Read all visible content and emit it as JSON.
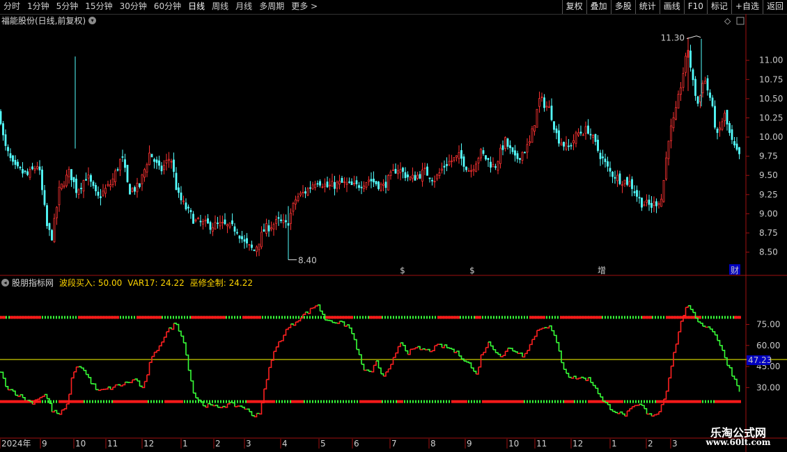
{
  "toolbar": {
    "tabs": [
      "分时",
      "1分钟",
      "5分钟",
      "15分钟",
      "30分钟",
      "60分钟",
      "日线",
      "周线",
      "月线",
      "多周期",
      "更多 >"
    ],
    "active_tab": "日线",
    "buttons": [
      "复权",
      "叠加",
      "多股",
      "统计",
      "画线",
      "F10",
      "标记",
      "+自选",
      "返回"
    ]
  },
  "main_panel": {
    "title": "福能股份(日线,前复权)",
    "high_label": "11.30",
    "low_label": "8.40",
    "markers": [
      "$",
      "$",
      "增",
      "财"
    ]
  },
  "indicator_panel": {
    "name": "股朋指标网",
    "items": [
      {
        "label": "波段买入:",
        "value": "50.00"
      },
      {
        "label": "VAR17:",
        "value": "24.22"
      },
      {
        "label": "巫修全制:",
        "value": "24.22"
      }
    ],
    "current_value_tag": "47.23"
  },
  "date_axis": [
    "2024年",
    "9",
    "10",
    "11",
    "12",
    "1",
    "2",
    "3",
    "4",
    "5",
    "6",
    "7",
    "8",
    "9",
    "10",
    "11",
    "12",
    "1",
    "2",
    "3"
  ],
  "watermark": {
    "line1": "乐淘公式网",
    "line2": "www.60lt.com"
  },
  "colors": {
    "up": "#ff3232",
    "down": "#54ffff",
    "ind_up": "#ff2020",
    "ind_down": "#38ff38",
    "yellow": "#ffff00",
    "tag_bg": "#0000c0"
  },
  "chart_data": [
    {
      "type": "candlestick",
      "title": "福能股份(日线,前复权)",
      "y_ticks": [
        8.5,
        8.75,
        9.0,
        9.25,
        9.5,
        9.75,
        10.0,
        10.25,
        10.5,
        10.75,
        11.0
      ],
      "ylim": [
        8.36,
        11.46
      ],
      "annotated_high": 11.3,
      "annotated_low": 8.4,
      "approx_close_path": [
        [
          0,
          10.3
        ],
        [
          6,
          9.9
        ],
        [
          20,
          9.6
        ],
        [
          40,
          9.5
        ],
        [
          55,
          9.65
        ],
        [
          62,
          9.2
        ],
        [
          68,
          8.8
        ],
        [
          75,
          8.7
        ],
        [
          85,
          9.3
        ],
        [
          100,
          9.55
        ],
        [
          110,
          9.3
        ],
        [
          125,
          9.5
        ],
        [
          140,
          9.2
        ],
        [
          160,
          9.4
        ],
        [
          175,
          9.75
        ],
        [
          185,
          9.3
        ],
        [
          200,
          9.35
        ],
        [
          215,
          9.8
        ],
        [
          230,
          9.55
        ],
        [
          245,
          9.75
        ],
        [
          255,
          9.25
        ],
        [
          265,
          9.1
        ],
        [
          280,
          8.9
        ],
        [
          300,
          8.85
        ],
        [
          320,
          8.85
        ],
        [
          340,
          8.8
        ],
        [
          352,
          8.6
        ],
        [
          365,
          8.52
        ],
        [
          380,
          8.8
        ],
        [
          400,
          8.9
        ],
        [
          412,
          8.85
        ],
        [
          425,
          9.2
        ],
        [
          440,
          9.3
        ],
        [
          455,
          9.45
        ],
        [
          470,
          9.35
        ],
        [
          490,
          9.4
        ],
        [
          510,
          9.35
        ],
        [
          530,
          9.45
        ],
        [
          550,
          9.35
        ],
        [
          570,
          9.6
        ],
        [
          590,
          9.45
        ],
        [
          610,
          9.55
        ],
        [
          625,
          9.45
        ],
        [
          640,
          9.65
        ],
        [
          660,
          9.75
        ],
        [
          675,
          9.55
        ],
        [
          690,
          9.8
        ],
        [
          710,
          9.6
        ],
        [
          725,
          9.95
        ],
        [
          740,
          9.7
        ],
        [
          760,
          9.9
        ],
        [
          775,
          10.5
        ],
        [
          790,
          10.35
        ],
        [
          800,
          10.0
        ],
        [
          815,
          9.85
        ],
        [
          830,
          10.05
        ],
        [
          845,
          10.1
        ],
        [
          860,
          9.8
        ],
        [
          875,
          9.55
        ],
        [
          890,
          9.45
        ],
        [
          905,
          9.4
        ],
        [
          920,
          9.15
        ],
        [
          935,
          9.1
        ],
        [
          950,
          9.2
        ],
        [
          960,
          10.0
        ],
        [
          970,
          10.3
        ],
        [
          980,
          10.8
        ],
        [
          988,
          11.15
        ],
        [
          995,
          10.7
        ],
        [
          1003,
          10.4
        ],
        [
          1010,
          10.8
        ],
        [
          1020,
          10.5
        ],
        [
          1030,
          10.0
        ],
        [
          1040,
          10.3
        ],
        [
          1050,
          9.95
        ],
        [
          1060,
          9.75
        ]
      ]
    },
    {
      "type": "line",
      "name": "股朋指标网",
      "y_ticks": [
        30.0,
        45.0,
        60.0,
        75.0
      ],
      "ylim": [
        -6,
        102
      ],
      "levels": [
        80,
        50,
        20
      ],
      "series_values": {
        "波段买入": 50.0,
        "VAR17": 24.22,
        "巫修全制": 24.22
      },
      "approx_path": [
        [
          0,
          41
        ],
        [
          10,
          30
        ],
        [
          25,
          25
        ],
        [
          45,
          19
        ],
        [
          55,
          23
        ],
        [
          65,
          25
        ],
        [
          75,
          13
        ],
        [
          85,
          11
        ],
        [
          95,
          16
        ],
        [
          105,
          42
        ],
        [
          115,
          46
        ],
        [
          125,
          38
        ],
        [
          140,
          27
        ],
        [
          160,
          30
        ],
        [
          180,
          33
        ],
        [
          195,
          36
        ],
        [
          205,
          28
        ],
        [
          215,
          48
        ],
        [
          230,
          62
        ],
        [
          240,
          70
        ],
        [
          252,
          76
        ],
        [
          262,
          66
        ],
        [
          270,
          45
        ],
        [
          278,
          25
        ],
        [
          290,
          18
        ],
        [
          310,
          16
        ],
        [
          330,
          18
        ],
        [
          350,
          16
        ],
        [
          362,
          10
        ],
        [
          372,
          12
        ],
        [
          380,
          30
        ],
        [
          390,
          52
        ],
        [
          400,
          62
        ],
        [
          412,
          72
        ],
        [
          420,
          75
        ],
        [
          430,
          80
        ],
        [
          445,
          85
        ],
        [
          455,
          90
        ],
        [
          465,
          79
        ],
        [
          480,
          77
        ],
        [
          500,
          74
        ],
        [
          510,
          62
        ],
        [
          520,
          44
        ],
        [
          530,
          40
        ],
        [
          540,
          48
        ],
        [
          550,
          37
        ],
        [
          560,
          44
        ],
        [
          570,
          58
        ],
        [
          575,
          63
        ],
        [
          585,
          55
        ],
        [
          600,
          58
        ],
        [
          615,
          56
        ],
        [
          630,
          60
        ],
        [
          645,
          58
        ],
        [
          660,
          53
        ],
        [
          675,
          46
        ],
        [
          683,
          38
        ],
        [
          690,
          52
        ],
        [
          700,
          62
        ],
        [
          710,
          57
        ],
        [
          720,
          52
        ],
        [
          730,
          58
        ],
        [
          740,
          56
        ],
        [
          750,
          53
        ],
        [
          760,
          60
        ],
        [
          770,
          70
        ],
        [
          780,
          74
        ],
        [
          790,
          73
        ],
        [
          800,
          60
        ],
        [
          808,
          45
        ],
        [
          818,
          37
        ],
        [
          830,
          37
        ],
        [
          845,
          36
        ],
        [
          855,
          30
        ],
        [
          865,
          20
        ],
        [
          880,
          14
        ],
        [
          895,
          10
        ],
        [
          910,
          16
        ],
        [
          920,
          18
        ],
        [
          930,
          10
        ],
        [
          945,
          12
        ],
        [
          955,
          25
        ],
        [
          965,
          50
        ],
        [
          975,
          72
        ],
        [
          985,
          89
        ],
        [
          995,
          82
        ],
        [
          1005,
          76
        ],
        [
          1015,
          73
        ],
        [
          1025,
          70
        ],
        [
          1035,
          58
        ],
        [
          1045,
          46
        ],
        [
          1055,
          35
        ],
        [
          1063,
          27
        ]
      ]
    }
  ]
}
